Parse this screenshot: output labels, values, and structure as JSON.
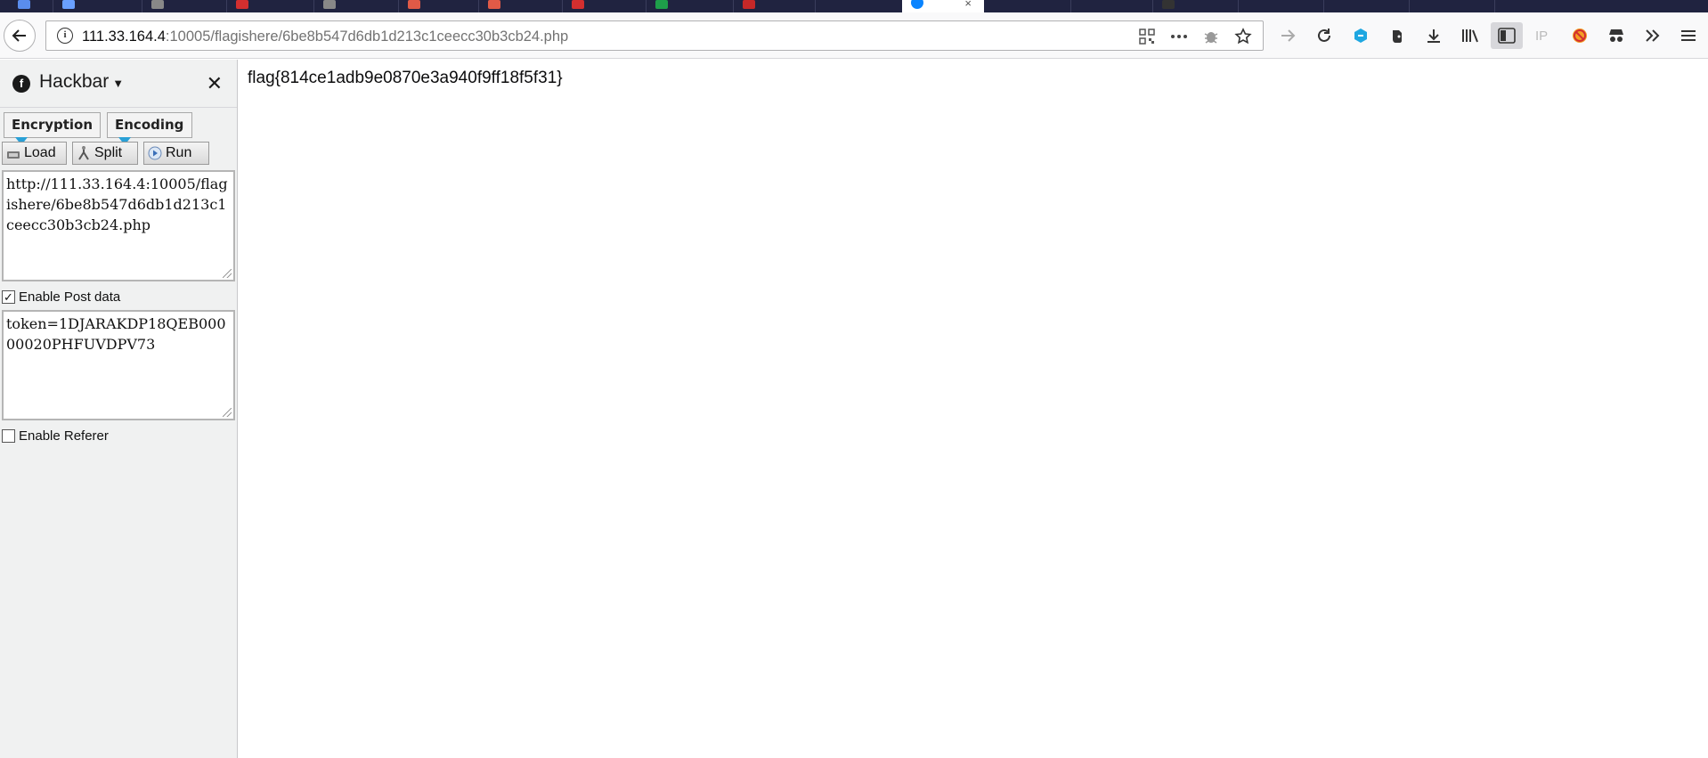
{
  "browser": {
    "url_host": "111.33.164.4",
    "url_rest": ":10005/flagishere/6be8b547d6db1d213c1ceecc30b3cb24.php",
    "colors": {
      "tabstrip": "#202340",
      "active_tab_favicon": "#0a84ff"
    }
  },
  "sidebar": {
    "title": "Hackbar",
    "encryption_label": "Encryption",
    "encoding_label": "Encoding",
    "load_label": "Load",
    "split_label": "Split",
    "run_label": "Run",
    "url_value": "http://111.33.164.4:10005/flagishere/6be8b547d6db1d213c1ceecc30b3cb24.php",
    "post_enabled": true,
    "post_label": "Enable Post data",
    "post_value": "token=1DJARAKDP18QEB00000020PHFUVDPV73",
    "referer_enabled": false,
    "referer_label": "Enable Referer"
  },
  "page": {
    "text": "flag{814ce1adb9e0870e3a940f9ff18f5f31}"
  }
}
